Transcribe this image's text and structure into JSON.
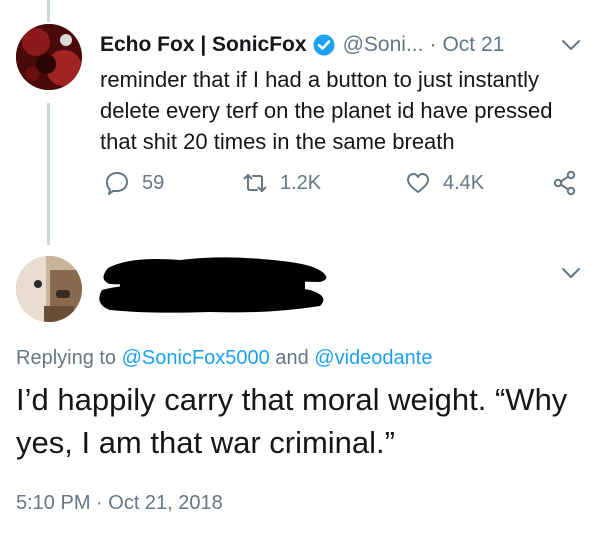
{
  "tweet": {
    "author_name": "Echo Fox | SonicFox",
    "handle": "@Soni...",
    "separator": "·",
    "date": "Oct 21",
    "text": "reminder that if I had a button to just instantly delete every terf on the planet id have pressed that shit 20 times in the same breath",
    "reply_count": "59",
    "retweet_count": "1.2K",
    "like_count": "4.4K",
    "icons": [
      "verified-badge-icon",
      "chevron-down-icon",
      "reply-icon",
      "retweet-icon",
      "like-icon",
      "share-icon"
    ]
  },
  "reply": {
    "replying_prefix": "Replying to",
    "mention_1": "@SonicFox5000",
    "and_word": "and",
    "mention_2": "@videodante",
    "text": "I’d happily carry that moral weight. “Why yes, I am that war criminal.”",
    "timestamp": "5:10 PM · Oct 21, 2018"
  },
  "colors": {
    "accent": "#1da1f2",
    "secondary_text": "#657786",
    "primary_text": "#14171a",
    "thread_line": "#ccd6dd"
  }
}
